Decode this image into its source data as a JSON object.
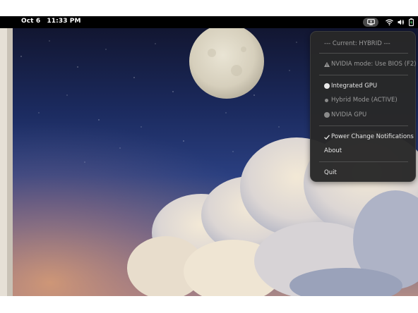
{
  "topbar": {
    "date": "Oct 6",
    "time": "11:33 PM",
    "tray": {
      "app_icon": "gpu-switcher-icon",
      "wifi_icon": "wifi-icon",
      "volume_icon": "volume-icon",
      "battery_icon": "battery-charging-icon"
    }
  },
  "menu": {
    "current": "--- Current: HYBRID ---",
    "nvidia_mode": "NVIDIA mode: Use BIOS (F2)",
    "nvidia_mode_icon": "warning-icon",
    "options": [
      {
        "label": "Integrated GPU",
        "state": "enabled"
      },
      {
        "label": "Hybrid Mode (ACTIVE)",
        "state": "active-disabled"
      },
      {
        "label": "NVIDIA GPU",
        "state": "disabled"
      }
    ],
    "notifications_label": "Power Change Notifications",
    "notifications_checked": "true",
    "about_label": "About",
    "quit_label": "Quit"
  },
  "colors": {
    "menu_bg": "#282828",
    "topbar_bg": "#000000",
    "sky_top": "#141a3c",
    "sky_bottom": "#c89a8c"
  }
}
